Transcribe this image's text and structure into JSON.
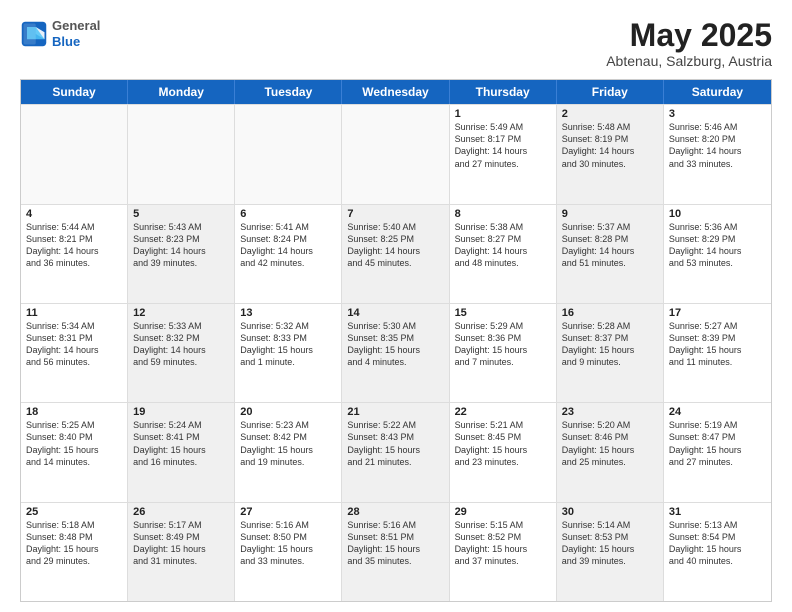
{
  "logo": {
    "general": "General",
    "blue": "Blue"
  },
  "title": "May 2025",
  "location": "Abtenau, Salzburg, Austria",
  "header_days": [
    "Sunday",
    "Monday",
    "Tuesday",
    "Wednesday",
    "Thursday",
    "Friday",
    "Saturday"
  ],
  "weeks": [
    [
      {
        "day": "",
        "text": "",
        "empty": true
      },
      {
        "day": "",
        "text": "",
        "empty": true
      },
      {
        "day": "",
        "text": "",
        "empty": true
      },
      {
        "day": "",
        "text": "",
        "empty": true
      },
      {
        "day": "1",
        "text": "Sunrise: 5:49 AM\nSunset: 8:17 PM\nDaylight: 14 hours\nand 27 minutes."
      },
      {
        "day": "2",
        "text": "Sunrise: 5:48 AM\nSunset: 8:19 PM\nDaylight: 14 hours\nand 30 minutes.",
        "shaded": true
      },
      {
        "day": "3",
        "text": "Sunrise: 5:46 AM\nSunset: 8:20 PM\nDaylight: 14 hours\nand 33 minutes."
      }
    ],
    [
      {
        "day": "4",
        "text": "Sunrise: 5:44 AM\nSunset: 8:21 PM\nDaylight: 14 hours\nand 36 minutes."
      },
      {
        "day": "5",
        "text": "Sunrise: 5:43 AM\nSunset: 8:23 PM\nDaylight: 14 hours\nand 39 minutes.",
        "shaded": true
      },
      {
        "day": "6",
        "text": "Sunrise: 5:41 AM\nSunset: 8:24 PM\nDaylight: 14 hours\nand 42 minutes."
      },
      {
        "day": "7",
        "text": "Sunrise: 5:40 AM\nSunset: 8:25 PM\nDaylight: 14 hours\nand 45 minutes.",
        "shaded": true
      },
      {
        "day": "8",
        "text": "Sunrise: 5:38 AM\nSunset: 8:27 PM\nDaylight: 14 hours\nand 48 minutes."
      },
      {
        "day": "9",
        "text": "Sunrise: 5:37 AM\nSunset: 8:28 PM\nDaylight: 14 hours\nand 51 minutes.",
        "shaded": true
      },
      {
        "day": "10",
        "text": "Sunrise: 5:36 AM\nSunset: 8:29 PM\nDaylight: 14 hours\nand 53 minutes."
      }
    ],
    [
      {
        "day": "11",
        "text": "Sunrise: 5:34 AM\nSunset: 8:31 PM\nDaylight: 14 hours\nand 56 minutes."
      },
      {
        "day": "12",
        "text": "Sunrise: 5:33 AM\nSunset: 8:32 PM\nDaylight: 14 hours\nand 59 minutes.",
        "shaded": true
      },
      {
        "day": "13",
        "text": "Sunrise: 5:32 AM\nSunset: 8:33 PM\nDaylight: 15 hours\nand 1 minute."
      },
      {
        "day": "14",
        "text": "Sunrise: 5:30 AM\nSunset: 8:35 PM\nDaylight: 15 hours\nand 4 minutes.",
        "shaded": true
      },
      {
        "day": "15",
        "text": "Sunrise: 5:29 AM\nSunset: 8:36 PM\nDaylight: 15 hours\nand 7 minutes."
      },
      {
        "day": "16",
        "text": "Sunrise: 5:28 AM\nSunset: 8:37 PM\nDaylight: 15 hours\nand 9 minutes.",
        "shaded": true
      },
      {
        "day": "17",
        "text": "Sunrise: 5:27 AM\nSunset: 8:39 PM\nDaylight: 15 hours\nand 11 minutes."
      }
    ],
    [
      {
        "day": "18",
        "text": "Sunrise: 5:25 AM\nSunset: 8:40 PM\nDaylight: 15 hours\nand 14 minutes."
      },
      {
        "day": "19",
        "text": "Sunrise: 5:24 AM\nSunset: 8:41 PM\nDaylight: 15 hours\nand 16 minutes.",
        "shaded": true
      },
      {
        "day": "20",
        "text": "Sunrise: 5:23 AM\nSunset: 8:42 PM\nDaylight: 15 hours\nand 19 minutes."
      },
      {
        "day": "21",
        "text": "Sunrise: 5:22 AM\nSunset: 8:43 PM\nDaylight: 15 hours\nand 21 minutes.",
        "shaded": true
      },
      {
        "day": "22",
        "text": "Sunrise: 5:21 AM\nSunset: 8:45 PM\nDaylight: 15 hours\nand 23 minutes."
      },
      {
        "day": "23",
        "text": "Sunrise: 5:20 AM\nSunset: 8:46 PM\nDaylight: 15 hours\nand 25 minutes.",
        "shaded": true
      },
      {
        "day": "24",
        "text": "Sunrise: 5:19 AM\nSunset: 8:47 PM\nDaylight: 15 hours\nand 27 minutes."
      }
    ],
    [
      {
        "day": "25",
        "text": "Sunrise: 5:18 AM\nSunset: 8:48 PM\nDaylight: 15 hours\nand 29 minutes."
      },
      {
        "day": "26",
        "text": "Sunrise: 5:17 AM\nSunset: 8:49 PM\nDaylight: 15 hours\nand 31 minutes.",
        "shaded": true
      },
      {
        "day": "27",
        "text": "Sunrise: 5:16 AM\nSunset: 8:50 PM\nDaylight: 15 hours\nand 33 minutes."
      },
      {
        "day": "28",
        "text": "Sunrise: 5:16 AM\nSunset: 8:51 PM\nDaylight: 15 hours\nand 35 minutes.",
        "shaded": true
      },
      {
        "day": "29",
        "text": "Sunrise: 5:15 AM\nSunset: 8:52 PM\nDaylight: 15 hours\nand 37 minutes."
      },
      {
        "day": "30",
        "text": "Sunrise: 5:14 AM\nSunset: 8:53 PM\nDaylight: 15 hours\nand 39 minutes.",
        "shaded": true
      },
      {
        "day": "31",
        "text": "Sunrise: 5:13 AM\nSunset: 8:54 PM\nDaylight: 15 hours\nand 40 minutes."
      }
    ]
  ]
}
